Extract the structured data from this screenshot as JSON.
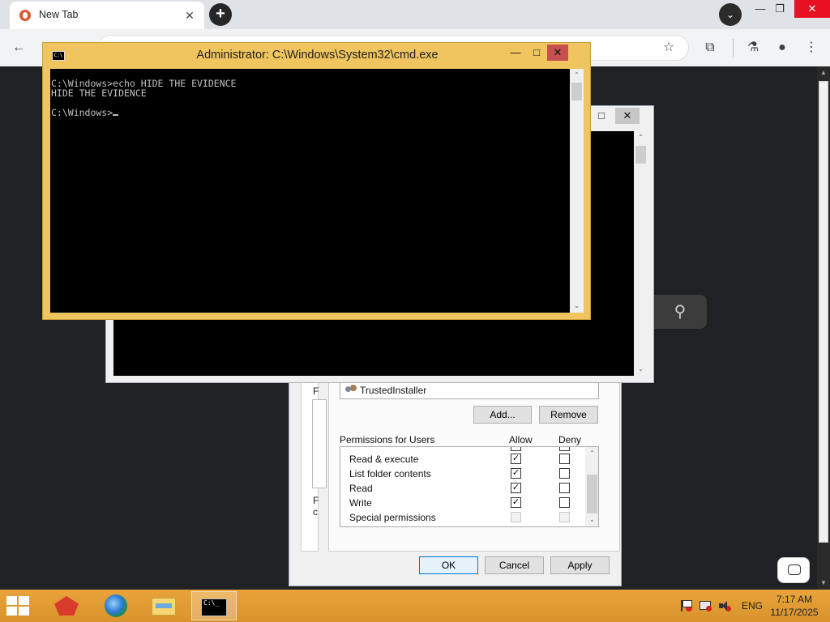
{
  "browser": {
    "tab": {
      "title": "New Tab",
      "close_glyph": "✕",
      "favicon": "duckduckgo-icon"
    },
    "new_tab_glyph": "+",
    "tab_search_glyph": "⌄",
    "window_controls": {
      "minimize": "—",
      "restore": "❐",
      "close": "✕"
    },
    "toolbar": {
      "back_glyph": "←",
      "bookmark_glyph": "☆",
      "extensions_glyph": "⧉",
      "labs_glyph": "⚗",
      "profile_glyph": "●",
      "menu_glyph": "⋮"
    },
    "search_glyph": "⚲",
    "scroll_up": "▲",
    "scroll_down": "▼"
  },
  "cmd_active": {
    "title": "Administrator: C:\\Windows\\System32\\cmd.exe",
    "icon_text": "C:\\",
    "controls": {
      "minimize": "—",
      "maximize": "□",
      "close": "✕"
    },
    "lines": [
      "C:\\Windows>echo HIDE THE EVIDENCE",
      "HIDE THE EVIDENCE"
    ],
    "prompt": "C:\\Windows>",
    "scroll_up": "⌃",
    "scroll_down": "⌄"
  },
  "cmd_back": {
    "controls": {
      "maximize": "□",
      "close": "✕"
    },
    "scroll_up": "⌃",
    "scroll_down": "⌄"
  },
  "permissions": {
    "left_label_top": "F",
    "left_label_mid": "F",
    "left_label_mid2": "c",
    "group_user": "TrustedInstaller",
    "add_button": "Add...",
    "remove_button": "Remove",
    "permissions_for": "Permissions for Users",
    "allow_header": "Allow",
    "deny_header": "Deny",
    "rows": [
      {
        "name": "Read & execute",
        "allow": "✓",
        "deny": ""
      },
      {
        "name": "List folder contents",
        "allow": "✓",
        "deny": ""
      },
      {
        "name": "Read",
        "allow": "✓",
        "deny": ""
      },
      {
        "name": "Write",
        "allow": "✓",
        "deny": ""
      },
      {
        "name": "Special permissions",
        "allow": "",
        "deny": ""
      }
    ],
    "ok_button": "OK",
    "cancel_button": "Cancel",
    "apply_button": "Apply",
    "scroll_up": "⌃",
    "scroll_down": "⌄"
  },
  "taskbar": {
    "cmd_icon_text": "C:\\_",
    "language": "ENG",
    "time": "7:17 AM",
    "date": "11/17/2025"
  }
}
